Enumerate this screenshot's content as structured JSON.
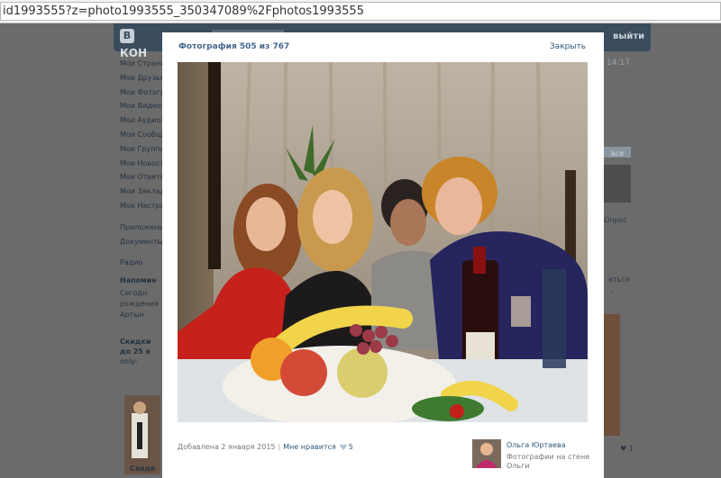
{
  "browser": {
    "url": "id1993555?z=photo1993555_350347089%2Fphotos1993555"
  },
  "header": {
    "logo_letter": "В",
    "logo_text": "КОН",
    "exit_label": "выйти",
    "time": "14:17"
  },
  "sidebar": {
    "items": [
      {
        "label": "Мои Страни"
      },
      {
        "label": "Мои Друзья"
      },
      {
        "label": "Мои Фотогр"
      },
      {
        "label": "Мои Видеоз"
      },
      {
        "label": "Мои Аудиоз"
      },
      {
        "label": "Мои Сообщ"
      },
      {
        "label": "Мои Группы"
      },
      {
        "label": "Мои Новост"
      },
      {
        "label": "Мои Ответы"
      },
      {
        "label": "Мои Заклад"
      },
      {
        "label": "Мои Настро"
      }
    ],
    "extra": [
      {
        "label": "Приложени"
      },
      {
        "label": "Документы"
      }
    ],
    "radio": "Радио"
  },
  "reminder": {
    "title": "Напомин",
    "line1": "Сегодн",
    "line2": "рождения",
    "line3": "Артын"
  },
  "ad": {
    "title1": "Скидки",
    "title2": "до 25 в",
    "domain": "only-",
    "bottom": "Сваде"
  },
  "right_side": {
    "badge": "все",
    "link": "Опрос",
    "text1": "аться",
    "text2": "-",
    "count": "♥ 1"
  },
  "viewer": {
    "title": "Фотография 505 из 767",
    "close_label": "Закрыть",
    "added": "Добавлена 2 января 2015",
    "separator": "|",
    "like_label": "Мне нравится",
    "like_count": "5",
    "owner_name": "Ольга Юртаева",
    "album": "Фотографии на стене Ольги"
  },
  "colors": {
    "link": "#2b587a",
    "title": "#45688e",
    "overlay": "#6b6b6b",
    "header": "#3b4c5f"
  }
}
